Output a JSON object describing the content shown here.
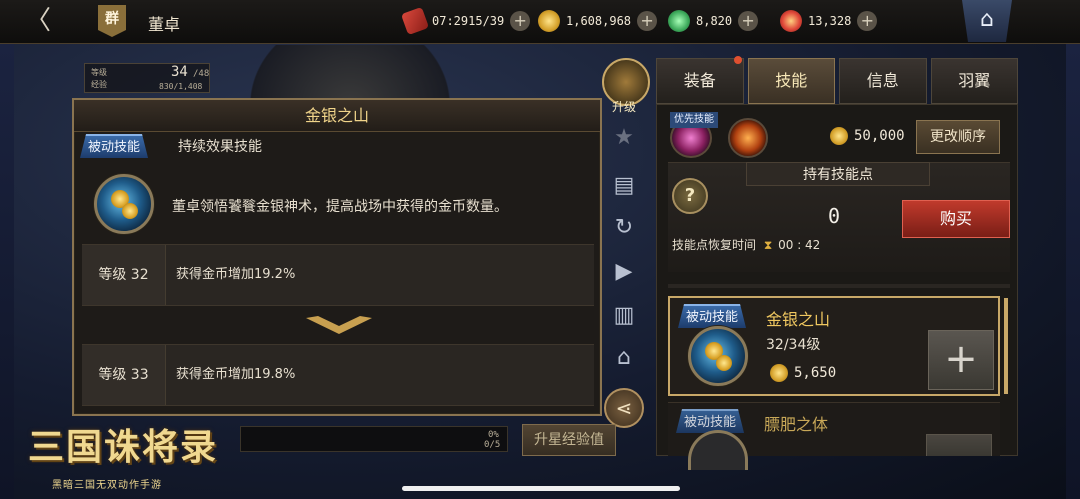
{
  "topbar": {
    "faction": "群",
    "hero_name": "董卓",
    "resources": [
      {
        "name": "stamina",
        "value": "07:2915/39",
        "icon": "scroll-icon"
      },
      {
        "name": "gold",
        "value": "1,608,968",
        "icon": "coin-icon"
      },
      {
        "name": "jade",
        "value": "8,820",
        "icon": "jade-icon"
      },
      {
        "name": "ingot",
        "value": "13,328",
        "icon": "ingot-icon"
      }
    ],
    "plus": "+",
    "back": "〈"
  },
  "level_badge": {
    "label_level": "等级",
    "label_exp": "经验",
    "level": "34",
    "max": "/48",
    "exp": "830/1,408"
  },
  "popup": {
    "title": "金银之山",
    "tag": "被动技能",
    "subtitle": "持续效果技能",
    "description": "董卓领悟饕餮金银神术，提高战场中获得的金币数量。",
    "levels": [
      {
        "label": "等级 32",
        "effect": "获得金币增加19.2%"
      },
      {
        "label": "等级 33",
        "effect": "获得金币增加19.8%"
      }
    ]
  },
  "side_menu": {
    "upgrade_label": "升级"
  },
  "tabs": [
    {
      "label": "装备"
    },
    {
      "label": "技能"
    },
    {
      "label": "信息"
    },
    {
      "label": "羽翼"
    }
  ],
  "priority": {
    "tag": "优先技能",
    "cost": "50,000",
    "change_order": "更改顺序"
  },
  "skill_points": {
    "title": "持有技能点",
    "help": "?",
    "count": "0",
    "buy": "购买",
    "recover_label": "技能点恢复时间",
    "recover_time": "00 : 42"
  },
  "skill_cards": [
    {
      "tag": "被动技能",
      "name": "金银之山",
      "level": "32/34级",
      "cost": "5,650"
    },
    {
      "tag": "被动技能",
      "name": "膘肥之体"
    }
  ],
  "bottom": {
    "exp_pct": "0%",
    "exp_count": "0/5",
    "star_exp_button": "升星经验值",
    "logo_title": "三国诛将录",
    "logo_sub": "黑暗三国无双动作手游"
  },
  "colors": {
    "accent_gold": "#c8a868",
    "passive_blue": "#2c5a98",
    "buy_red": "#b03428"
  }
}
